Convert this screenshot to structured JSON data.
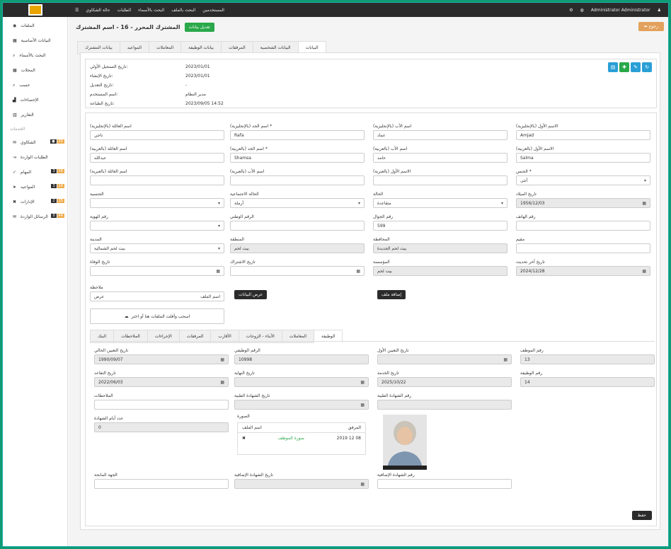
{
  "topbar": {
    "menu": [
      "المستخدمين",
      "البحث بالملف",
      "البحث بالأسماء",
      "الطلبات",
      "حالة الشكاوي"
    ],
    "user": "Administrator Administrator"
  },
  "sidebar": {
    "items": [
      "الملفات",
      "البيانات الأساسية",
      "البحث بالأسماء",
      "المحلات",
      "حسب",
      "الإحصاءات",
      "التقارير"
    ],
    "section": "الخدمات",
    "sub": [
      {
        "label": "الشكاوي",
        "a": "●",
        "b": "25"
      },
      {
        "label": "الطلبات الواردة",
        "a": "",
        "b": ""
      },
      {
        "label": "المهام",
        "a": "3",
        "b": "16"
      },
      {
        "label": "المواعيد",
        "a": "3",
        "b": "14"
      },
      {
        "label": "الإدارات",
        "a": "2",
        "b": "15"
      },
      {
        "label": "الرسائل الواردة",
        "a": "0",
        "b": "44"
      }
    ]
  },
  "title": {
    "text": "المشترك المحرر - 16 - اسم المشترك",
    "badge": "تعديل بيانات",
    "back": "رجوع"
  },
  "tabs": [
    "البيانات",
    "البيانات الشخصية",
    "المرفقات",
    "بيانات الوظيفة",
    "المعاملات",
    "المواعيد",
    "بيانات المشترك"
  ],
  "info": {
    "rows": [
      {
        "k": "تاريخ التسجيل الأولي:",
        "v": "2023/01/01"
      },
      {
        "k": "تاريخ الإنشاء:",
        "v": "2023/01/01"
      },
      {
        "k": "تاريخ التعديل:",
        "v": "-"
      },
      {
        "k": "اسم المستخدم:",
        "v": "مدير النظام"
      },
      {
        "k": "تاريخ الطباعة:",
        "v": "2023/09/05 14:52"
      }
    ]
  },
  "form": {
    "r1": [
      {
        "l": "الاسم الأول (بالإنجليزية)",
        "v": "Amjad"
      },
      {
        "l": "اسم الأب (بالإنجليزية)",
        "v": "عماد"
      },
      {
        "l": "اسم الجد (بالإنجليزية) *",
        "v": "Rafa"
      },
      {
        "l": "اسم العائلة (بالإنجليزية)",
        "v": "ناجي"
      }
    ],
    "r2": [
      {
        "l": "الاسم الأول (بالعربية)",
        "v": "Salma"
      },
      {
        "l": "اسم الأب (بالعربية)",
        "v": "حامد"
      },
      {
        "l": "اسم الجد (بالعربية) *",
        "v": "Shamsa"
      },
      {
        "l": "اسم العائلة (بالعربية)",
        "v": "عبدالله"
      }
    ],
    "r3": [
      {
        "l": "الجنس *",
        "v": "أنثى"
      },
      {
        "l": "الاسم الأول (بالعبرية)",
        "v": ""
      },
      {
        "l": "اسم الأب (بالعبرية)",
        "v": ""
      },
      {
        "l": "اسم العائلة (بالعبرية)",
        "v": ""
      }
    ],
    "r4": [
      {
        "l": "تاريخ الميلاد",
        "v": "1956/12/03"
      },
      {
        "l": "الحالة",
        "v": "متقاعدة"
      },
      {
        "l": "الحالة الاجتماعية",
        "v": "أرملة"
      },
      {
        "l": "الجنسية",
        "v": ""
      }
    ],
    "r5": [
      {
        "l": "رقم الهاتف",
        "v": ""
      },
      {
        "l": "رقم الجوال",
        "v": "599"
      },
      {
        "l": "الرقم الوطني",
        "v": ""
      },
      {
        "l": "رقم الهوية",
        "v": ""
      }
    ],
    "r6": [
      {
        "l": "مقيم",
        "v": ""
      },
      {
        "l": "المحافظة",
        "v": "بيت لحم الجديدة"
      },
      {
        "l": "المنطقة",
        "v": "بيت لحم"
      },
      {
        "l": "المدينة",
        "v": "بيت لحم الشمالية"
      }
    ],
    "r7": [
      {
        "l": "تاريخ آخر تحديث",
        "v": "2024/12/28"
      },
      {
        "l": "المؤسسة",
        "v": "بيت لحم"
      },
      {
        "l": "تاريخ الاشتراك",
        "v": ""
      },
      {
        "l": "تاريخ الوفاة",
        "v": ""
      }
    ],
    "notes_label": "ملاحظة",
    "notes_v": "اسم الملف",
    "notes_t": "عرض",
    "btn_a": "عرض البيانات",
    "btn_b": "إضافة ملف",
    "upload": "اسحب وأفلت الملفات هنا أو اختر"
  },
  "subtabs": [
    "الوظيفة",
    "المعاملات",
    "الأبناء - الزوجات",
    "الأقارب",
    "المرفقات",
    "الإجراءات",
    "الملاحظات",
    "البنك"
  ],
  "sub": {
    "r1": [
      {
        "l": "رقم الموظف",
        "v": "13"
      },
      {
        "l": "تاريخ التعيين الأول",
        "v": ""
      },
      {
        "l": "الرقم الوظيفي",
        "v": "10998"
      },
      {
        "l": "تاريخ التعيين الحالي",
        "v": "1990/09/07"
      }
    ],
    "r2": [
      {
        "l": "رقم الوظيفة",
        "v": "14"
      },
      {
        "l": "تاريخ الخدمة",
        "v": "2025/10/22"
      },
      {
        "l": "تاريخ النهاية",
        "v": ""
      },
      {
        "l": "تاريخ التقاعد",
        "v": "2022/06/03"
      }
    ],
    "r3": [
      {
        "l": "رقم الشهادة الطبية",
        "v": ""
      },
      {
        "l": "تاريخ الشهادة الطبية",
        "v": ""
      },
      {
        "l": "الملاحظات",
        "v": ""
      }
    ],
    "r4": [
      {
        "l": "عدد أيام الشهادة",
        "v": "0"
      }
    ],
    "tbl": {
      "label": "الصورة",
      "h1": "المرفق",
      "h2": "اسم الملف",
      "c1": "2019 12 08",
      "c2": "صورة الموظف"
    },
    "r5": [
      {
        "l": "رقم الشهادة الإضافية",
        "v": ""
      },
      {
        "l": "تاريخ الشهادة الإضافية",
        "v": ""
      },
      {
        "l": "الجهة المانحة",
        "v": ""
      }
    ],
    "save": "حفظ"
  }
}
